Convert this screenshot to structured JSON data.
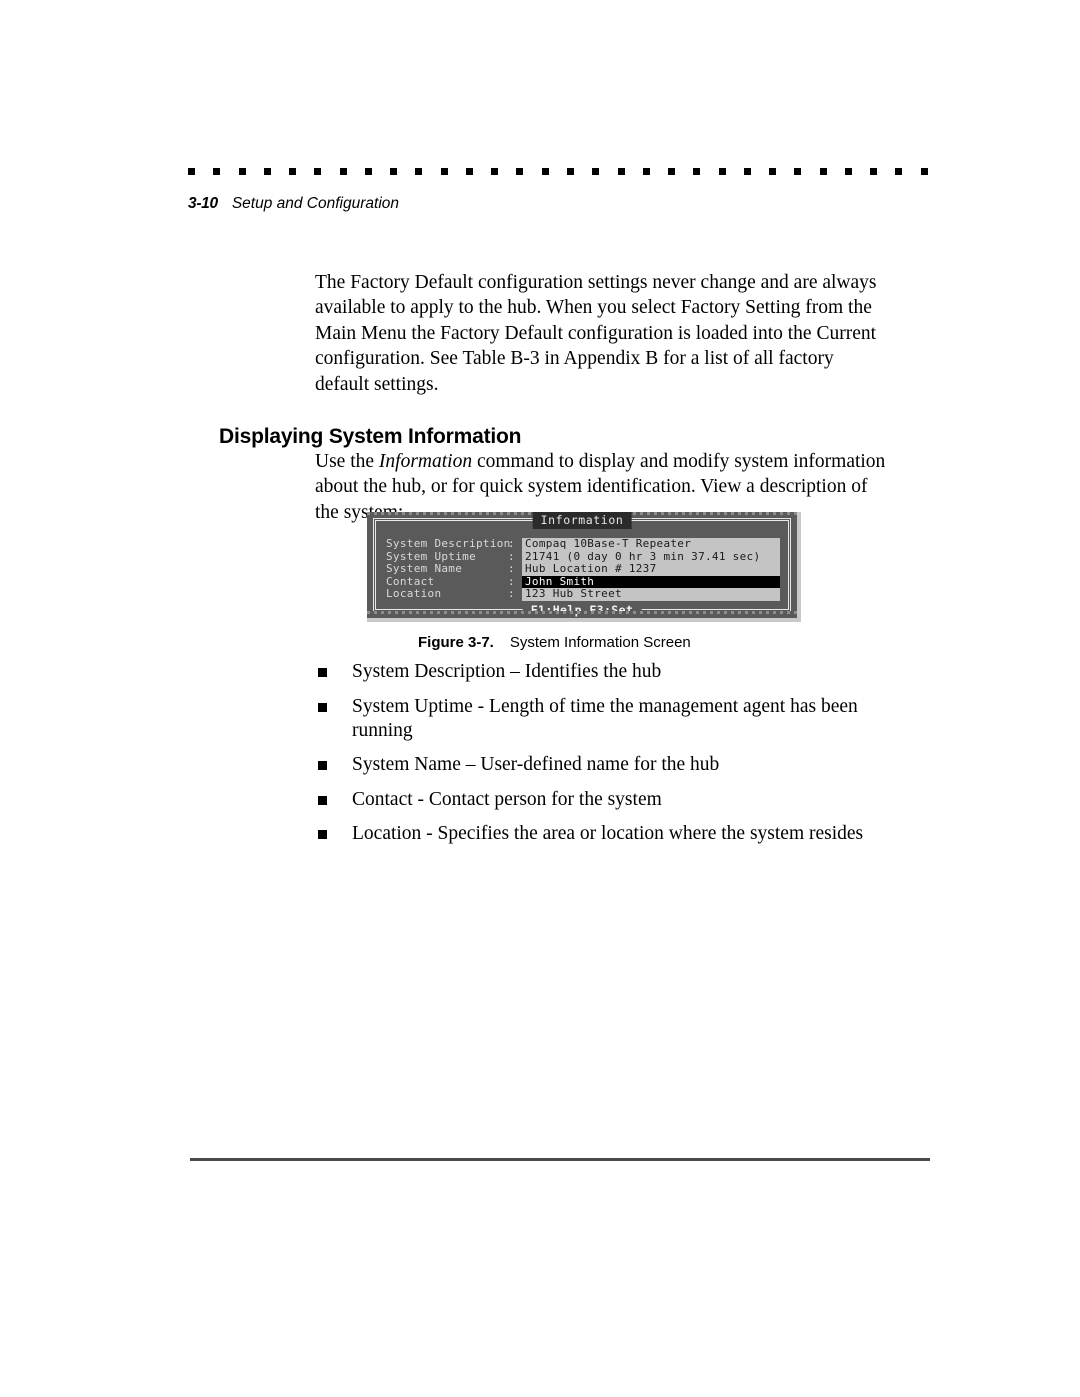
{
  "page_header": {
    "page_number": "3-10",
    "section_title": "Setup and Configuration",
    "dot_count": 30
  },
  "paragraphs": {
    "factory_default": {
      "part1": "The Factory Default configuration settings never change and are always available to apply to the hub.  When you select Factory Setting from the Main Menu the Factory Default configuration is loaded into the Current configuration. See Table B-3 in Appendix B for a list of all factory default settings."
    },
    "use_information": {
      "lead": "Use the ",
      "emphasis": "Information",
      "tail": " command to display and modify system information about the hub, or for quick system identification. View a description of the system:"
    }
  },
  "section_heading": "Displaying System Information",
  "terminal": {
    "title": "Information",
    "footer": "F1:Help.F3:Set",
    "rows": [
      {
        "label": "System Description",
        "separator": ":",
        "value": "Compaq 10Base-T Repeater",
        "selected": false
      },
      {
        "label": "System Uptime",
        "separator": ":",
        "value": "21741 (0 day 0 hr 3 min 37.41 sec)",
        "selected": false
      },
      {
        "label": "System Name",
        "separator": ":",
        "value": "Hub Location # 1237",
        "selected": false
      },
      {
        "label": "Contact",
        "separator": ":",
        "value": "John Smith",
        "selected": true
      },
      {
        "label": "Location",
        "separator": ":",
        "value": "123 Hub Street",
        "selected": false
      }
    ],
    "colors": {
      "screen_background": "#5a5a5a",
      "field_background": "#c4c4c4",
      "selected_background": "#000000",
      "label_text": "#d9d9d9",
      "title_background": "#2b2b2b"
    }
  },
  "figure_caption": {
    "label": "Figure 3-7.",
    "text": "System Information Screen"
  },
  "bullets": [
    "System Description – Identifies the hub",
    "System Uptime - Length of time the management agent has been running",
    "System Name – User-defined name for the hub",
    "Contact - Contact person for the system",
    "Location - Specifies the area or location where the system resides"
  ]
}
